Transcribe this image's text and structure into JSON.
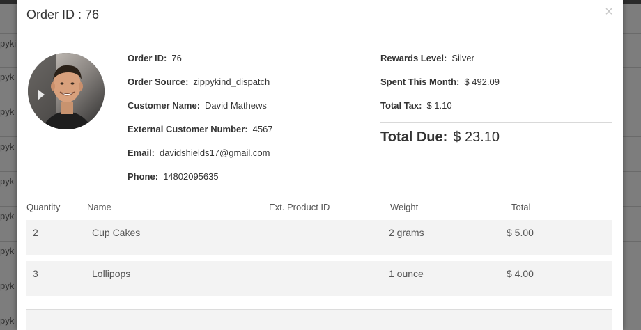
{
  "backdrop": {
    "row_fragments": [
      "pyki",
      "pyk",
      "pyk",
      "pyk",
      "pyk",
      "pyk",
      "pyk",
      "pyk",
      "pyk"
    ]
  },
  "modal": {
    "title": "Order ID : 76",
    "close_label": "×"
  },
  "order": {
    "left": [
      {
        "label": "Order ID:",
        "value": "76"
      },
      {
        "label": "Order Source:",
        "value": "zippykind_dispatch"
      },
      {
        "label": "Customer Name:",
        "value": "David Mathews"
      },
      {
        "label": "External Customer Number:",
        "value": "4567"
      },
      {
        "label": "Email:",
        "value": "davidshields17@gmail.com"
      },
      {
        "label": "Phone:",
        "value": "14802095635"
      }
    ],
    "right": [
      {
        "label": "Rewards Level:",
        "value": "Silver"
      },
      {
        "label": "Spent This Month:",
        "value": "$ 492.09"
      },
      {
        "label": "Total Tax:",
        "value": "$ 1.10"
      }
    ],
    "total_due_label": "Total Due:",
    "total_due_value": "$ 23.10"
  },
  "table": {
    "headers": [
      "Quantity",
      "Name",
      "Ext. Product ID",
      "Weight",
      "Total"
    ],
    "rows": [
      {
        "quantity": "2",
        "name": "Cup Cakes",
        "ext_id": "",
        "weight": "2 grams",
        "total": "$ 5.00"
      },
      {
        "quantity": "3",
        "name": "Lollipops",
        "ext_id": "",
        "weight": "1 ounce",
        "total": "$ 4.00"
      }
    ]
  },
  "colors": {
    "backdrop": "#8a8a8a",
    "row_bg": "#f3f3f3",
    "text": "#333333"
  },
  "icons": {
    "close": "close-icon",
    "avatar": "customer-avatar"
  }
}
